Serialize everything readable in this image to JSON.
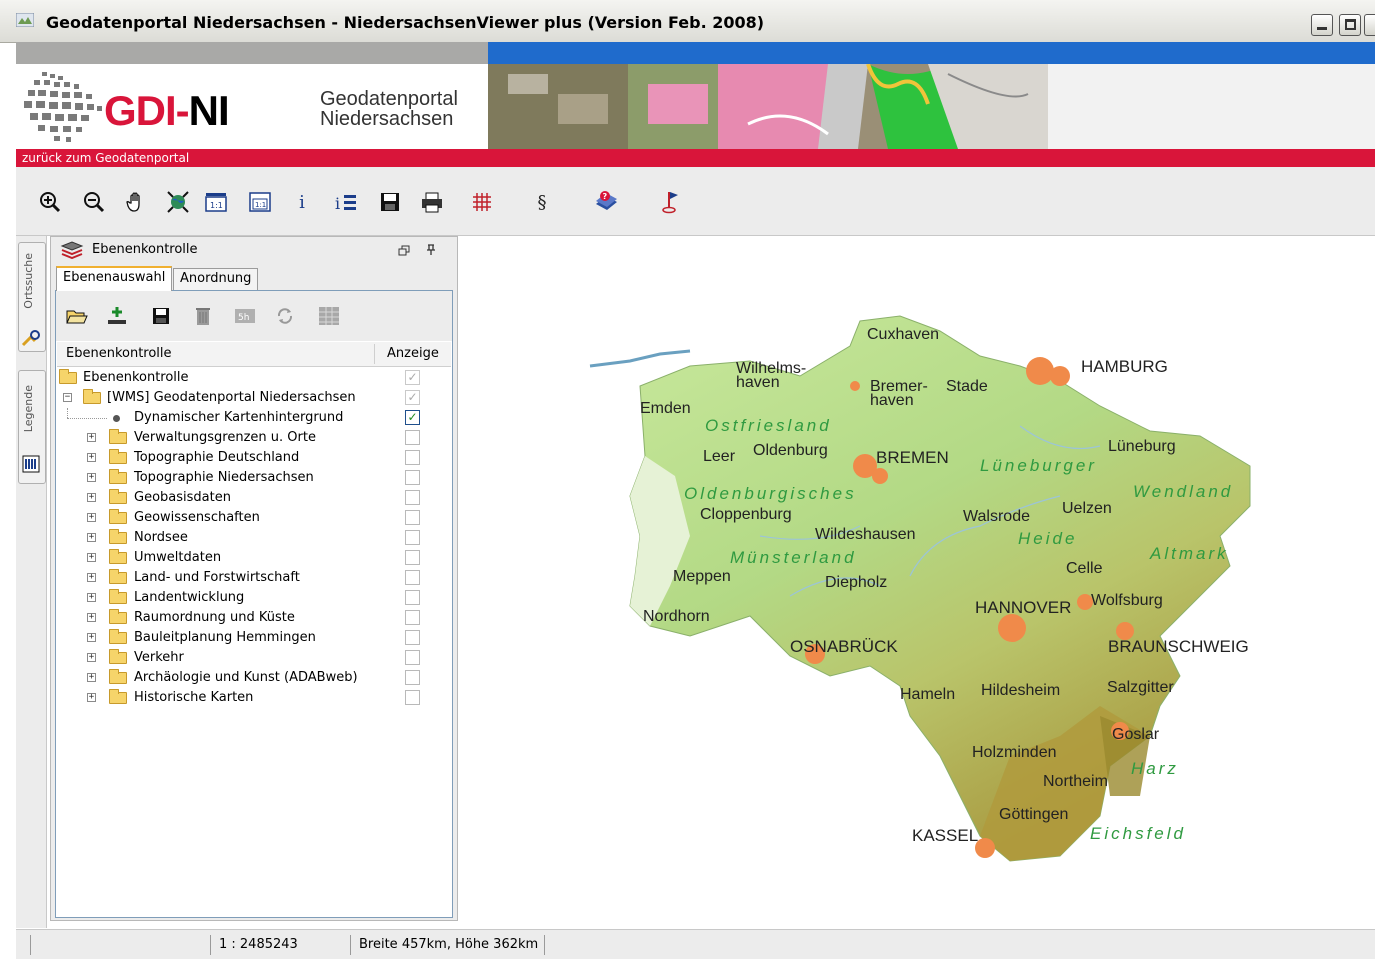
{
  "window": {
    "title": "Geodatenportal Niedersachsen - NiedersachsenViewer plus (Version Feb. 2008)"
  },
  "banner": {
    "logo_text": "GDI-NI",
    "portal_line1": "Geodatenportal",
    "portal_line2": "Niedersachsen",
    "back_link": "zurück zum Geodatenportal"
  },
  "toolbar": {
    "tools": [
      "zoom-in-icon",
      "zoom-out-icon",
      "pan-hand-icon",
      "full-extent-icon",
      "scale-1-icon",
      "scale-2-icon",
      "info-icon",
      "multi-info-icon",
      "save-icon",
      "print-icon",
      "grid-icon",
      "paragraph-icon",
      "help-book-icon",
      "flag-icon"
    ],
    "paragraph_symbol": "§",
    "info_symbol": "i"
  },
  "sidebar": {
    "tabs": [
      {
        "label": "Ortssuche"
      },
      {
        "label": "Legende"
      }
    ]
  },
  "panel": {
    "title": "Ebenenkontrolle",
    "tabs": [
      {
        "label": "Ebenenauswahl",
        "active": true
      },
      {
        "label": "Anordnung",
        "active": false
      }
    ],
    "columns": {
      "name": "Ebenenkontrolle",
      "display": "Anzeige"
    },
    "tree": [
      {
        "label": "Ebenenkontrolle",
        "level": 0,
        "type": "folder",
        "checked": "disabled"
      },
      {
        "label": "[WMS] Geodatenportal Niedersachsen",
        "level": 1,
        "type": "folder",
        "checked": "disabled"
      },
      {
        "label": "Dynamischer Kartenhintergrund",
        "level": 2,
        "type": "leaf",
        "checked": "checked"
      },
      {
        "label": "Verwaltungsgrenzen u. Orte",
        "level": 2,
        "type": "folder",
        "checked": "unchecked"
      },
      {
        "label": "Topographie Deutschland",
        "level": 2,
        "type": "folder",
        "checked": "unchecked"
      },
      {
        "label": "Topographie Niedersachsen",
        "level": 2,
        "type": "folder",
        "checked": "unchecked"
      },
      {
        "label": "Geobasisdaten",
        "level": 2,
        "type": "folder",
        "checked": "unchecked"
      },
      {
        "label": "Geowissenschaften",
        "level": 2,
        "type": "folder",
        "checked": "unchecked"
      },
      {
        "label": "Nordsee",
        "level": 2,
        "type": "folder",
        "checked": "unchecked"
      },
      {
        "label": "Umweltdaten",
        "level": 2,
        "type": "folder",
        "checked": "unchecked"
      },
      {
        "label": "Land- und Forstwirtschaft",
        "level": 2,
        "type": "folder",
        "checked": "unchecked"
      },
      {
        "label": "Landentwicklung",
        "level": 2,
        "type": "folder",
        "checked": "unchecked"
      },
      {
        "label": "Raumordnung und Küste",
        "level": 2,
        "type": "folder",
        "checked": "unchecked"
      },
      {
        "label": "Bauleitplanung Hemmingen",
        "level": 2,
        "type": "folder",
        "checked": "unchecked"
      },
      {
        "label": "Verkehr",
        "level": 2,
        "type": "folder",
        "checked": "unchecked"
      },
      {
        "label": "Archäologie und Kunst (ADABweb)",
        "level": 2,
        "type": "folder",
        "checked": "unchecked"
      },
      {
        "label": "Historische Karten",
        "level": 2,
        "type": "folder",
        "checked": "unchecked"
      }
    ]
  },
  "status": {
    "scale": "1 : 2485243",
    "extent": "Breite 457km, Höhe 362km"
  },
  "map": {
    "cities": [
      "Cuxhaven",
      "Wilhelms-",
      "haven",
      "Bremer-",
      "haven",
      "Stade",
      "HAMBURG",
      "Emden",
      "Leer",
      "Oldenburg",
      "BREMEN",
      "Lüneburg",
      "Cloppenburg",
      "Wildeshausen",
      "Walsrode",
      "Uelzen",
      "Meppen",
      "Diepholz",
      "Celle",
      "HANNOVER",
      "Wolfsburg",
      "Nordhorn",
      "OSNABRÜCK",
      "BRAUNSCHWEIG",
      "Hameln",
      "Hildesheim",
      "Salzgitter",
      "Goslar",
      "Holzminden",
      "Northeim",
      "Göttingen",
      "KASSEL"
    ],
    "regions": [
      "Ostfriesland",
      "Oldenburgisches",
      "Münsterland",
      "Lüneburger",
      "Heide",
      "Wendland",
      "Altmark",
      "Harz",
      "Eichsfeld"
    ]
  }
}
